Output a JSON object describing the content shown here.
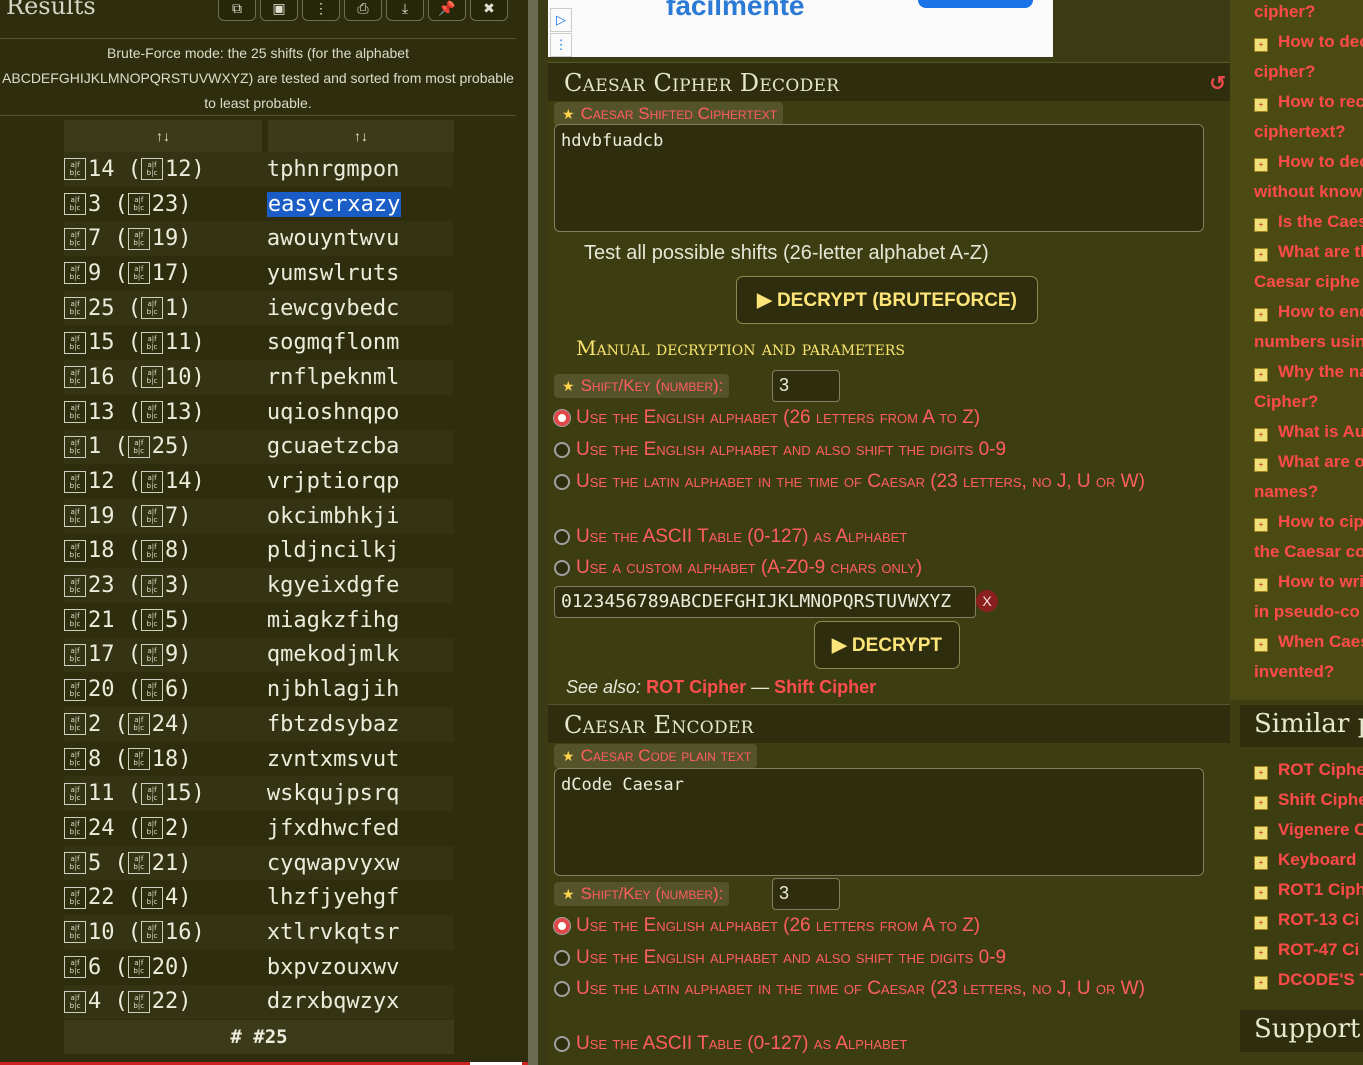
{
  "results": {
    "title": "Results",
    "toolbar": [
      "copy-icon",
      "screenshot-icon",
      "more-icon",
      "print-icon",
      "download-icon",
      "pin-icon",
      "close-icon"
    ],
    "description": "Brute-Force mode: the 25 shifts (for the alphabet ABCDEFGHIJKLMNOPQRSTUVWXYZ) are tested and sorted from most probable to least probable.",
    "sort_label_1": "↑↓",
    "sort_label_2": "↑↓",
    "rows": [
      {
        "shift": "14",
        "inverse": "12",
        "text": "tphnrgmpon"
      },
      {
        "shift": "3",
        "inverse": "23",
        "text": "easycrxazy",
        "selected": true
      },
      {
        "shift": "7",
        "inverse": "19",
        "text": "awouyntwvu"
      },
      {
        "shift": "9",
        "inverse": "17",
        "text": "yumswlruts"
      },
      {
        "shift": "25",
        "inverse": "1",
        "text": "iewcgvbedc"
      },
      {
        "shift": "15",
        "inverse": "11",
        "text": "sogmqflonm"
      },
      {
        "shift": "16",
        "inverse": "10",
        "text": "rnflpeknml"
      },
      {
        "shift": "13",
        "inverse": "13",
        "text": "uqioshnqpo"
      },
      {
        "shift": "1",
        "inverse": "25",
        "text": "gcuaetzcba"
      },
      {
        "shift": "12",
        "inverse": "14",
        "text": "vrjptiorqp"
      },
      {
        "shift": "19",
        "inverse": "7",
        "text": "okcimbhkji"
      },
      {
        "shift": "18",
        "inverse": "8",
        "text": "pldjncilkj"
      },
      {
        "shift": "23",
        "inverse": "3",
        "text": "kgyeixdgfe"
      },
      {
        "shift": "21",
        "inverse": "5",
        "text": "miagkzfihg"
      },
      {
        "shift": "17",
        "inverse": "9",
        "text": "qmekodjmlk"
      },
      {
        "shift": "20",
        "inverse": "6",
        "text": "njbhlagjih"
      },
      {
        "shift": "2",
        "inverse": "24",
        "text": "fbtzdsybaz"
      },
      {
        "shift": "8",
        "inverse": "18",
        "text": "zvntxmsvut"
      },
      {
        "shift": "11",
        "inverse": "15",
        "text": "wskqujpsrq"
      },
      {
        "shift": "24",
        "inverse": "2",
        "text": "jfxdhwcfed"
      },
      {
        "shift": "5",
        "inverse": "21",
        "text": "cyqwapvyxw"
      },
      {
        "shift": "22",
        "inverse": "4",
        "text": "lhzfjyehgf"
      },
      {
        "shift": "10",
        "inverse": "16",
        "text": "xtlrvkqtsr"
      },
      {
        "shift": "6",
        "inverse": "20",
        "text": "bxpvzouxwv"
      },
      {
        "shift": "4",
        "inverse": "22",
        "text": "dzrxbqwzyx"
      }
    ],
    "footer": "# #25"
  },
  "ad": {
    "text": "facilmente"
  },
  "decoder": {
    "title": "Caesar Cipher Decoder",
    "ciphertext_label": "Caesar Shifted Ciphertext",
    "ciphertext_value": "hdvbfuadcb",
    "test_all_note": "Test all possible shifts (26-letter alphabet A-Z)",
    "bruteforce_button": "▶ DECRYPT (BRUTEFORCE)",
    "manual_title": "Manual decryption and parameters",
    "shift_label": "Shift/Key (number):",
    "shift_value": "3",
    "options": [
      "Use the English alphabet (26 letters from A to Z)",
      "Use the English alphabet and also shift the digits 0-9",
      "Use the latin alphabet in the time of Caesar (23 letters, no J, U or W)",
      "Use the ASCII Table (0-127) as Alphabet",
      "Use a custom alphabet (A-Z0-9 chars only)"
    ],
    "custom_alphabet": "0123456789ABCDEFGHIJKLMNOPQRSTUVWXYZ",
    "clear_label": "X",
    "decrypt_button": "▶ DECRYPT",
    "see_also_label": "See also:",
    "see_also_links": [
      "ROT Cipher",
      "Shift Cipher"
    ],
    "see_also_sep": "—"
  },
  "encoder": {
    "title": "Caesar Encoder",
    "plaintext_label": "Caesar Code plain text",
    "plaintext_value": "dCode Caesar",
    "shift_label": "Shift/Key (number):",
    "shift_value": "3",
    "options": [
      "Use the English alphabet (26 letters from A to Z)",
      "Use the English alphabet and also shift the digits 0-9",
      "Use the latin alphabet in the time of Caesar (23 letters, no J, U or W)",
      "Use the ASCII Table (0-127) as Alphabet"
    ]
  },
  "sidebar": {
    "faq_links": [
      {
        "line1": "cipher?",
        "icon": false
      },
      {
        "line1": "How to dec",
        "icon": true
      },
      {
        "line1": "cipher?",
        "icon": false
      },
      {
        "line1": "How to rec",
        "icon": true
      },
      {
        "line1": "ciphertext?",
        "icon": false
      },
      {
        "line1": "How to dec",
        "icon": true
      },
      {
        "line1": "without know",
        "icon": false
      },
      {
        "line1": "Is the Caes",
        "icon": true
      },
      {
        "line1": "What are th",
        "icon": true
      },
      {
        "line1": "Caesar ciphe",
        "icon": false
      },
      {
        "line1": "How to enc",
        "icon": true
      },
      {
        "line1": "numbers usin",
        "icon": false
      },
      {
        "line1": "Why the na",
        "icon": true
      },
      {
        "line1": "Cipher?",
        "icon": false
      },
      {
        "line1": "What is Au",
        "icon": true
      },
      {
        "line1": "What are o",
        "icon": true
      },
      {
        "line1": "names?",
        "icon": false
      },
      {
        "line1": "How to cip",
        "icon": true
      },
      {
        "line1": "the Caesar co",
        "icon": false
      },
      {
        "line1": "How to wri",
        "icon": true
      },
      {
        "line1": "in pseudo-co",
        "icon": false
      },
      {
        "line1": "When Caes",
        "icon": true
      },
      {
        "line1": "invented?",
        "icon": false
      }
    ],
    "similar_title": "Similar pa",
    "similar_links": [
      "ROT Ciphe",
      "Shift Ciphe",
      "Vigenere C",
      "Keyboard",
      "ROT1 Ciph",
      "ROT-13 Ci",
      "ROT-47 Ci",
      "DCODE'S T"
    ],
    "support_title": "Support"
  }
}
